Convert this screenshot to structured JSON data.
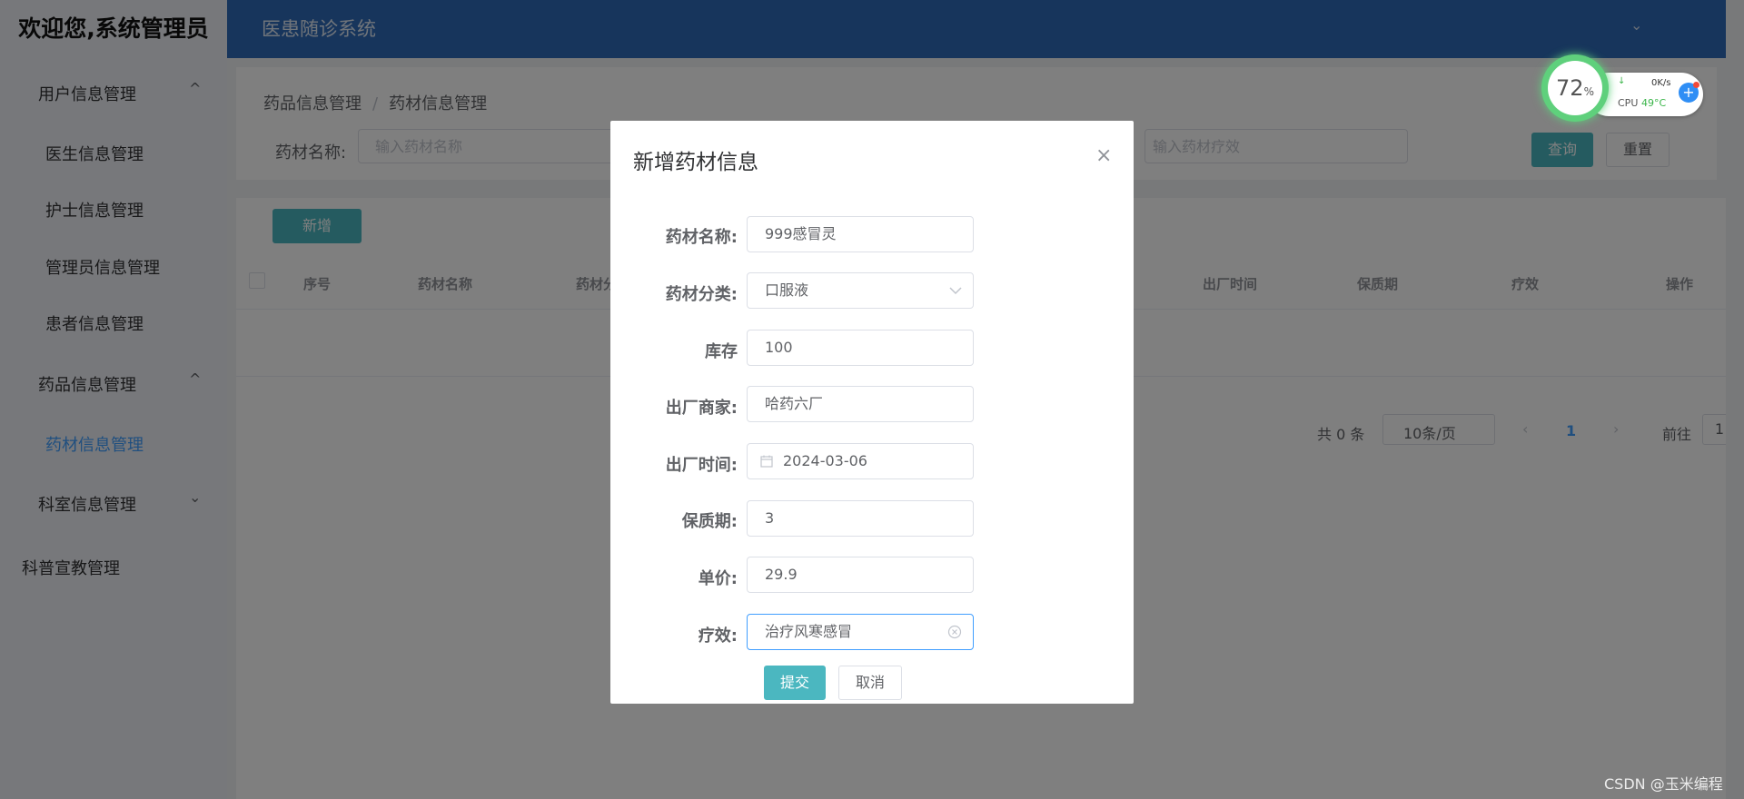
{
  "sidebar": {
    "welcome": "欢迎您,系统管理员",
    "groups": [
      {
        "label": "用户信息管理",
        "chevron": "^"
      },
      {
        "label": "药品信息管理",
        "chevron": "^"
      },
      {
        "label": "科室信息管理",
        "chevron": "⌄"
      }
    ],
    "user_items": [
      "医生信息管理",
      "护士信息管理",
      "管理员信息管理",
      "患者信息管理"
    ],
    "drug_items": [
      "药材信息管理"
    ],
    "standalone": "科普宣教管理"
  },
  "header": {
    "title": "医患随诊系统",
    "chevron": "⌄"
  },
  "breadcrumb": {
    "level1": "药品信息管理",
    "sep": "/",
    "level2": "药材信息管理"
  },
  "search": {
    "name_label": "药材名称:",
    "name_placeholder": "输入药材名称",
    "effect_placeholder": "输入药材疗效",
    "query_label": "查询",
    "reset_label": "重置"
  },
  "toolbar": {
    "add_label": "新增"
  },
  "table": {
    "headers": [
      "序号",
      "药材名称",
      "药材分",
      "出厂时间",
      "保质期",
      "疗效",
      "操作"
    ]
  },
  "pagination": {
    "total": "共 0 条",
    "page_size": "10条/页",
    "current": "1",
    "goto": "前往",
    "goto_value": "1"
  },
  "dialog": {
    "title": "新增药材信息",
    "close": "×",
    "fields": [
      {
        "label": "药材名称:",
        "value": "999感冒灵"
      },
      {
        "label": "药材分类:",
        "value": "口服液"
      },
      {
        "label": "库存",
        "value": "100"
      },
      {
        "label": "出厂商家:",
        "value": "哈药六厂"
      },
      {
        "label": "出厂时间:",
        "value": "2024-03-06"
      },
      {
        "label": "保质期:",
        "value": "3"
      },
      {
        "label": "单价:",
        "value": "29.9"
      },
      {
        "label": "疗效:",
        "value": "治疗风寒感冒"
      }
    ],
    "submit_label": "提交",
    "cancel_label": "取消"
  },
  "system_widget": {
    "percent": "72",
    "percent_unit": "%",
    "net": "0K/s",
    "cpu_label": "CPU",
    "cpu_temp": "49°C"
  },
  "watermark": "CSDN @玉米编程",
  "colors": {
    "header": "#2e6bb8",
    "accent": "#4bb7c0",
    "active_menu": "#409eff"
  }
}
